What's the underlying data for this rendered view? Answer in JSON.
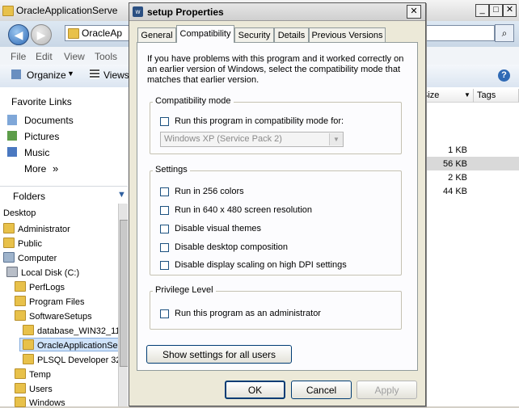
{
  "explorer": {
    "title": "OracleApplicationServe",
    "address": "OracleAp",
    "menu": [
      "File",
      "Edit",
      "View",
      "Tools"
    ],
    "toolbar": {
      "organize": "Organize",
      "views": "Views"
    },
    "favorite_links_header": "Favorite Links",
    "favorite_links": [
      "Documents",
      "Pictures",
      "Music",
      "More"
    ],
    "more_arrow": "»",
    "folders_header": "Folders",
    "tree": [
      "Desktop",
      "Administrator",
      "Public",
      "Computer",
      "Local Disk (C:)",
      "PerfLogs",
      "Program Files",
      "SoftwareSetups",
      "database_WIN32_11",
      "OracleApplicationSer",
      "PLSQL Developer 32b",
      "Temp",
      "Users",
      "Windows"
    ],
    "columns": {
      "size": "Size",
      "tags": "Tags"
    },
    "sizes": [
      "1 KB",
      "56 KB",
      "2 KB",
      "44 KB"
    ]
  },
  "dialog": {
    "title": "setup Properties",
    "tabs": [
      "General",
      "Compatibility",
      "Security",
      "Details",
      "Previous Versions"
    ],
    "active_tab": "Compatibility",
    "description": "If you have problems with this program and it worked correctly on an earlier version of Windows, select the compatibility mode that matches that earlier version.",
    "compat_group": {
      "title": "Compatibility mode",
      "checkbox": "Run this program in compatibility mode for:",
      "checked": false,
      "os_value": "Windows XP (Service Pack 2)"
    },
    "settings_group": {
      "title": "Settings",
      "options": [
        {
          "label": "Run in 256 colors",
          "checked": false
        },
        {
          "label": "Run in 640 x 480 screen resolution",
          "checked": false
        },
        {
          "label": "Disable visual themes",
          "checked": false
        },
        {
          "label": "Disable desktop composition",
          "checked": false
        },
        {
          "label": "Disable display scaling on high DPI settings",
          "checked": false
        }
      ]
    },
    "privilege_group": {
      "title": "Privilege Level",
      "checkbox": "Run this program as an administrator",
      "checked": false
    },
    "show_all_users": "Show settings for all users",
    "buttons": {
      "ok": "OK",
      "cancel": "Cancel",
      "apply": "Apply"
    }
  }
}
